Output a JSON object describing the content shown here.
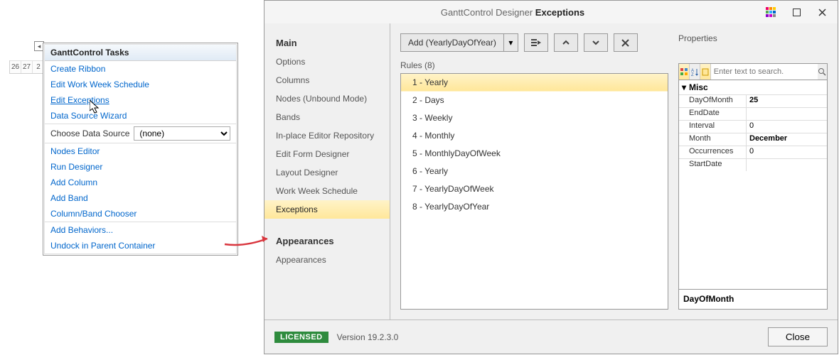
{
  "bg_cells": [
    "26",
    "27",
    "2"
  ],
  "context_menu": {
    "title": "GanttControl Tasks",
    "items_top": [
      "Create Ribbon",
      "Edit Work Week Schedule",
      "Edit Exceptions",
      "Data Source Wizard"
    ],
    "choose_ds_label": "Choose Data Source",
    "choose_ds_value": "(none)",
    "items_mid": [
      "Nodes Editor",
      "Run Designer",
      "Add Column",
      "Add Band",
      "Column/Band Chooser"
    ],
    "items_bot": [
      "Add Behaviors...",
      "Undock in Parent Container"
    ]
  },
  "designer": {
    "title_prefix": "GanttControl Designer",
    "title_strong": "Exceptions",
    "nav": {
      "group1": "Main",
      "items1": [
        "Options",
        "Columns",
        "Nodes (Unbound Mode)",
        "Bands",
        "In-place Editor Repository",
        "Edit Form Designer",
        "Layout Designer",
        "Work Week Schedule",
        "Exceptions"
      ],
      "selected1": "Exceptions",
      "group2": "Appearances",
      "items2": [
        "Appearances"
      ]
    },
    "add_combo": "Add (YearlyDayOfYear)",
    "rules_label": "Rules (8)",
    "rules": [
      "1 - Yearly",
      "2 - Days",
      "3 - Weekly",
      "4 - Monthly",
      "5 - MonthlyDayOfWeek",
      "6 - Yearly",
      "7 - YearlyDayOfWeek",
      "8 - YearlyDayOfYear"
    ],
    "rules_selected": "1 - Yearly",
    "props_label": "Properties",
    "props_search_placeholder": "Enter text to search.",
    "props_category": "Misc",
    "props": [
      {
        "name": "DayOfMonth",
        "value": "25",
        "bold": true
      },
      {
        "name": "EndDate",
        "value": ""
      },
      {
        "name": "Interval",
        "value": "0"
      },
      {
        "name": "Month",
        "value": "December",
        "bold": true
      },
      {
        "name": "Occurrences",
        "value": "0"
      },
      {
        "name": "StartDate",
        "value": ""
      }
    ],
    "props_desc": "DayOfMonth",
    "licensed": "LICENSED",
    "version": "Version 19.2.3.0",
    "close": "Close"
  }
}
